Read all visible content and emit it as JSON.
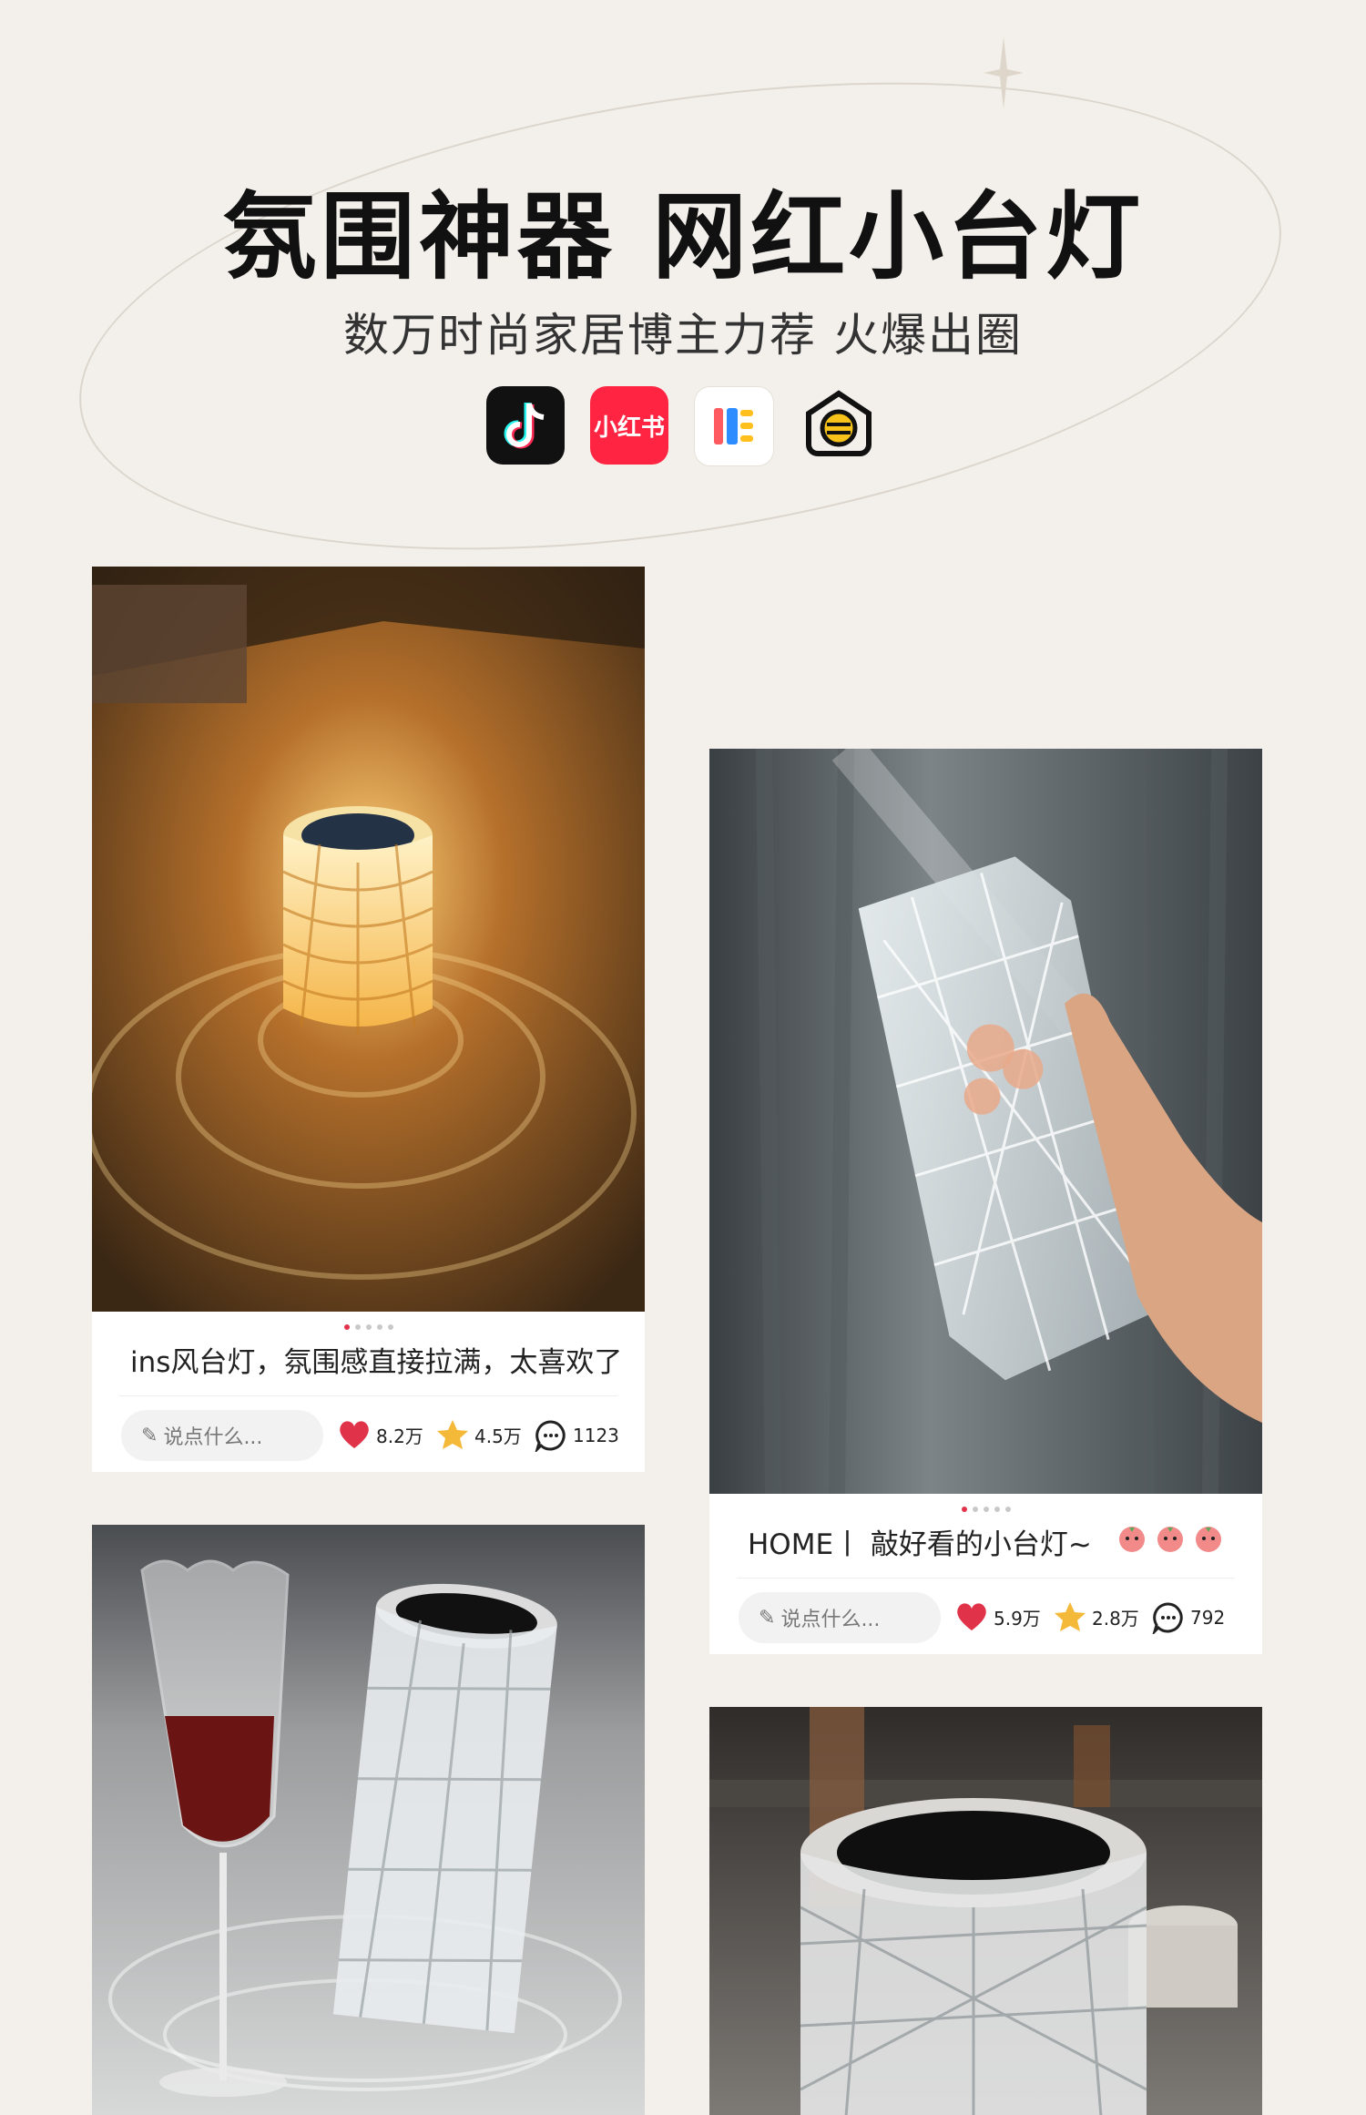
{
  "header": {
    "title": "氛围神器 网红小台灯",
    "subtitle": "数万时尚家居博主力荐 火爆出圈"
  },
  "apps": [
    {
      "name": "douyin-icon",
      "label": ""
    },
    {
      "name": "xiaohongshu-icon",
      "label": "小红书"
    },
    {
      "name": "kuaishou-icon",
      "label": ""
    },
    {
      "name": "zhihu-icon",
      "label": ""
    }
  ],
  "posts": [
    {
      "caption": "ins风台灯，氛围感直接拉满，太喜欢了",
      "comment_placeholder": "说点什么...",
      "likes": "8.2万",
      "favorites": "4.5万",
      "comments": "1123"
    },
    {
      "caption": "HOME丨 敲好看的小台灯~",
      "comment_placeholder": "说点什么...",
      "likes": "5.9万",
      "favorites": "2.8万",
      "comments": "792"
    }
  ],
  "colors": {
    "background": "#f3f0eb",
    "heart": "#e0334a",
    "star": "#f5b93a",
    "xiaohongshu": "#ff2442"
  }
}
